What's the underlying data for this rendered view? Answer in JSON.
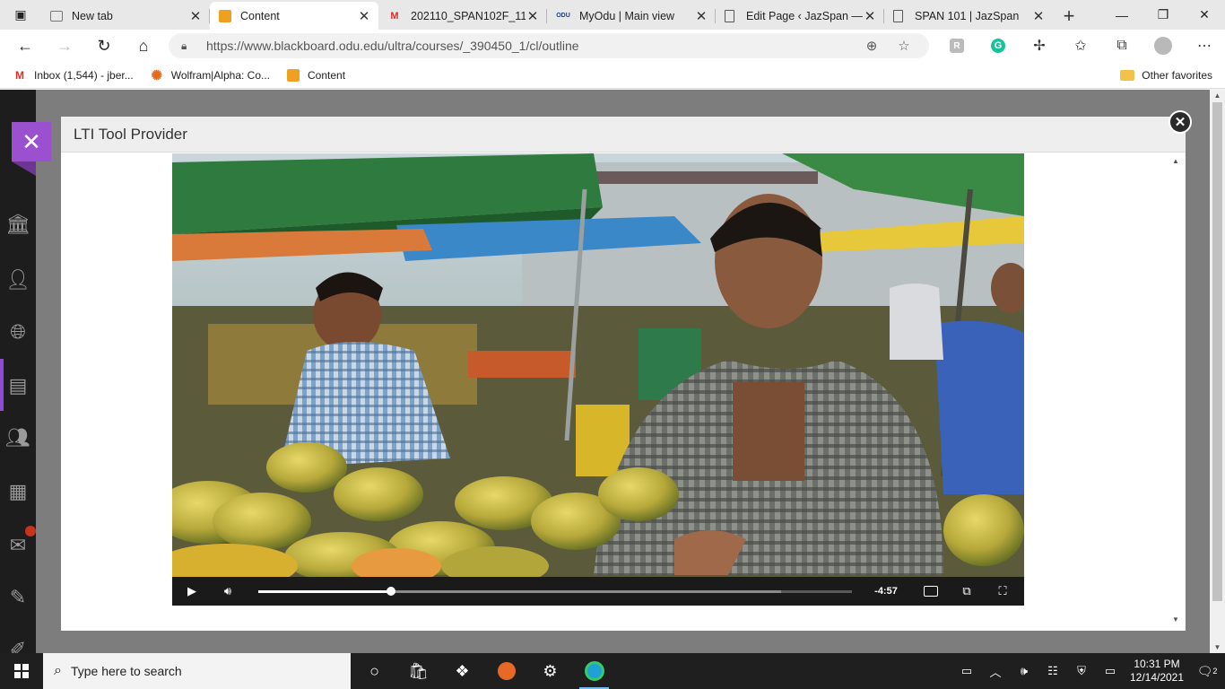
{
  "browser": {
    "tabs": [
      {
        "title": "New tab",
        "favicon": "new-tab-icon",
        "active": false
      },
      {
        "title": "Content",
        "favicon": "blackboard-icon",
        "active": true
      },
      {
        "title": "202110_SPAN102F_11",
        "favicon": "gmail-icon",
        "active": false
      },
      {
        "title": "MyOdu | Main view",
        "favicon": "odu-icon",
        "active": false
      },
      {
        "title": "Edit Page ‹ JazSpan —",
        "favicon": "page-icon",
        "active": false
      },
      {
        "title": "SPAN 101 | JazSpan",
        "favicon": "page-icon",
        "active": false
      }
    ],
    "url": "https://www.blackboard.odu.edu/ultra/courses/_390450_1/cl/outline",
    "bookmarks": [
      {
        "label": "Inbox (1,544) - jber...",
        "icon": "gmail-icon"
      },
      {
        "label": "Wolfram|Alpha: Co...",
        "icon": "wolfram-icon"
      },
      {
        "label": "Content",
        "icon": "blackboard-icon"
      }
    ],
    "other_favorites": "Other favorites",
    "grammarly_letter": "G",
    "reader_letter": "R",
    "gmail_letter": "M",
    "odu_letter": "ODU",
    "wolfram_glyph": "✺"
  },
  "modal": {
    "title": "LTI Tool Provider"
  },
  "video": {
    "time_remaining": "-4:57",
    "played_fraction": 0.223,
    "buffered_fraction": 0.881
  },
  "taskbar": {
    "search_placeholder": "Type here to search",
    "time": "10:31 PM",
    "date": "12/14/2021",
    "notification_count": "2"
  },
  "colors": {
    "bb_purple": "#9b50cf",
    "bb_nav_bg": "#1d1d1d",
    "taskbar_bg": "#1f1f1f"
  }
}
